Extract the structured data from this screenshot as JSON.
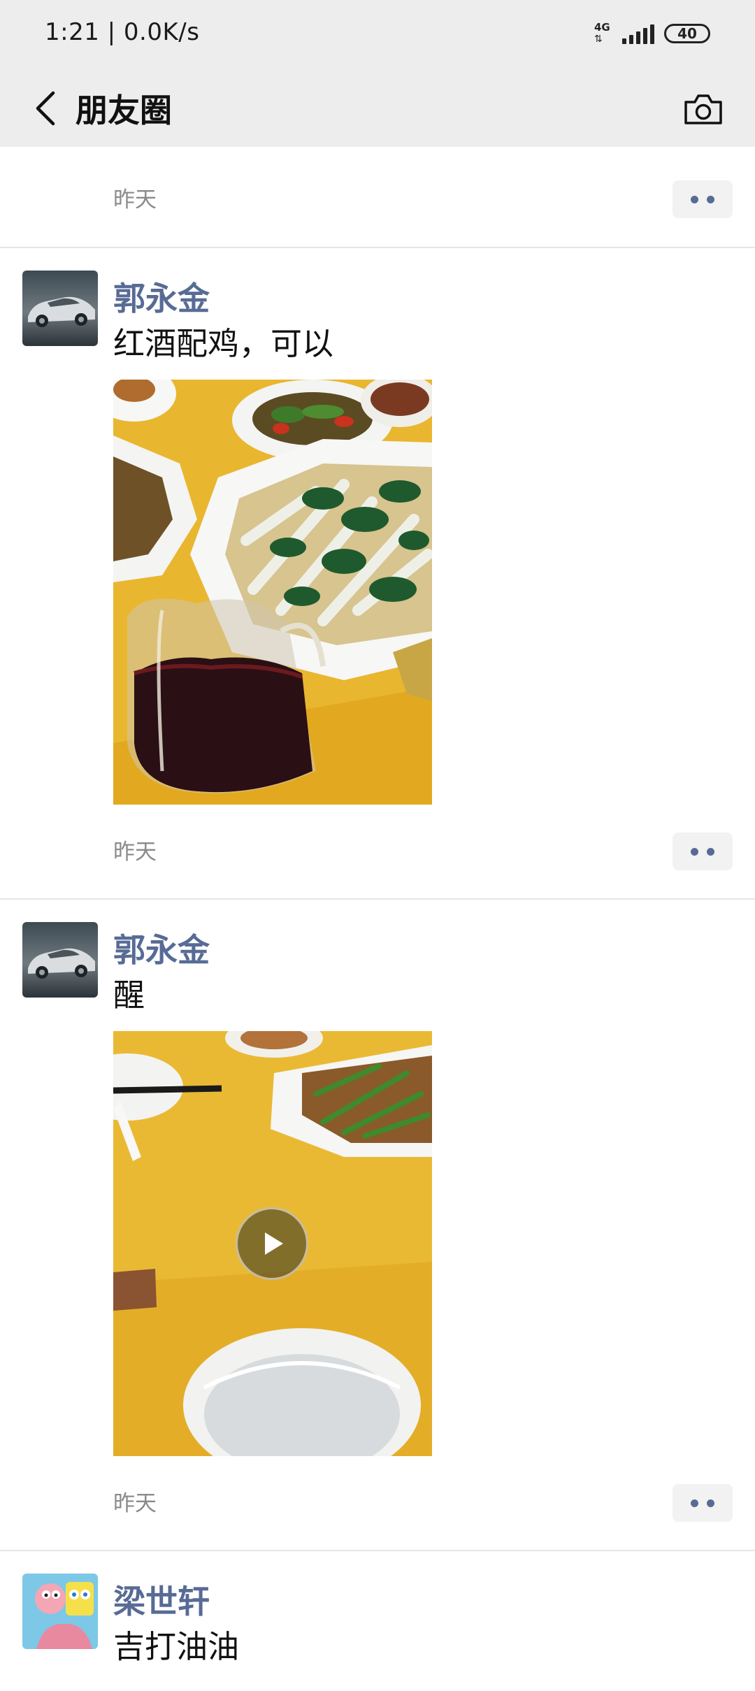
{
  "status_bar": {
    "time": "1:21 | 0.0K/s",
    "network": "4G",
    "network_arrows": "⇅",
    "battery": "40"
  },
  "nav": {
    "title": "朋友圈",
    "back_icon": "chevron-left-icon",
    "camera_icon": "camera-icon"
  },
  "feed": {
    "partial_post": {
      "time": "昨天"
    },
    "posts": [
      {
        "author": "郭永金",
        "text": "红酒配鸡，可以",
        "media_type": "photo",
        "time": "昨天"
      },
      {
        "author": "郭永金",
        "text": "醒",
        "media_type": "video",
        "time": "昨天"
      },
      {
        "author": "梁世轩",
        "text": "吉打油油"
      }
    ]
  },
  "colors": {
    "bar_bg": "#ededed",
    "author_name": "#576b95",
    "timestamp": "#8a8a8a",
    "divider": "#e6e6e6",
    "tablecloth": "#e8b42a"
  }
}
